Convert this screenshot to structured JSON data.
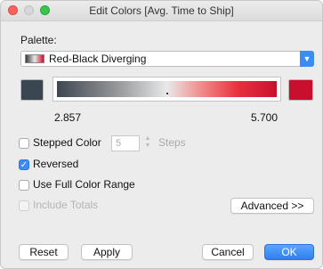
{
  "window": {
    "title": "Edit Colors [Avg. Time to Ship]"
  },
  "palette": {
    "label": "Palette:",
    "selected": "Red-Black Diverging"
  },
  "gradient": {
    "start_color": "#3a4652",
    "end_color": "#c8102e",
    "min_label": "2.857",
    "max_label": "5.700"
  },
  "options": {
    "stepped_color": {
      "label": "Stepped Color",
      "checked": false,
      "steps_value": "5",
      "steps_unit": "Steps"
    },
    "reversed": {
      "label": "Reversed",
      "checked": true
    },
    "use_full_color_range": {
      "label": "Use Full Color Range",
      "checked": false
    },
    "include_totals": {
      "label": "Include Totals",
      "checked": false,
      "disabled": true
    }
  },
  "buttons": {
    "advanced": "Advanced >>",
    "reset": "Reset",
    "apply": "Apply",
    "cancel": "Cancel",
    "ok": "OK"
  },
  "colors": {
    "accent": "#3b8cf5",
    "window_bg": "#ececec"
  }
}
